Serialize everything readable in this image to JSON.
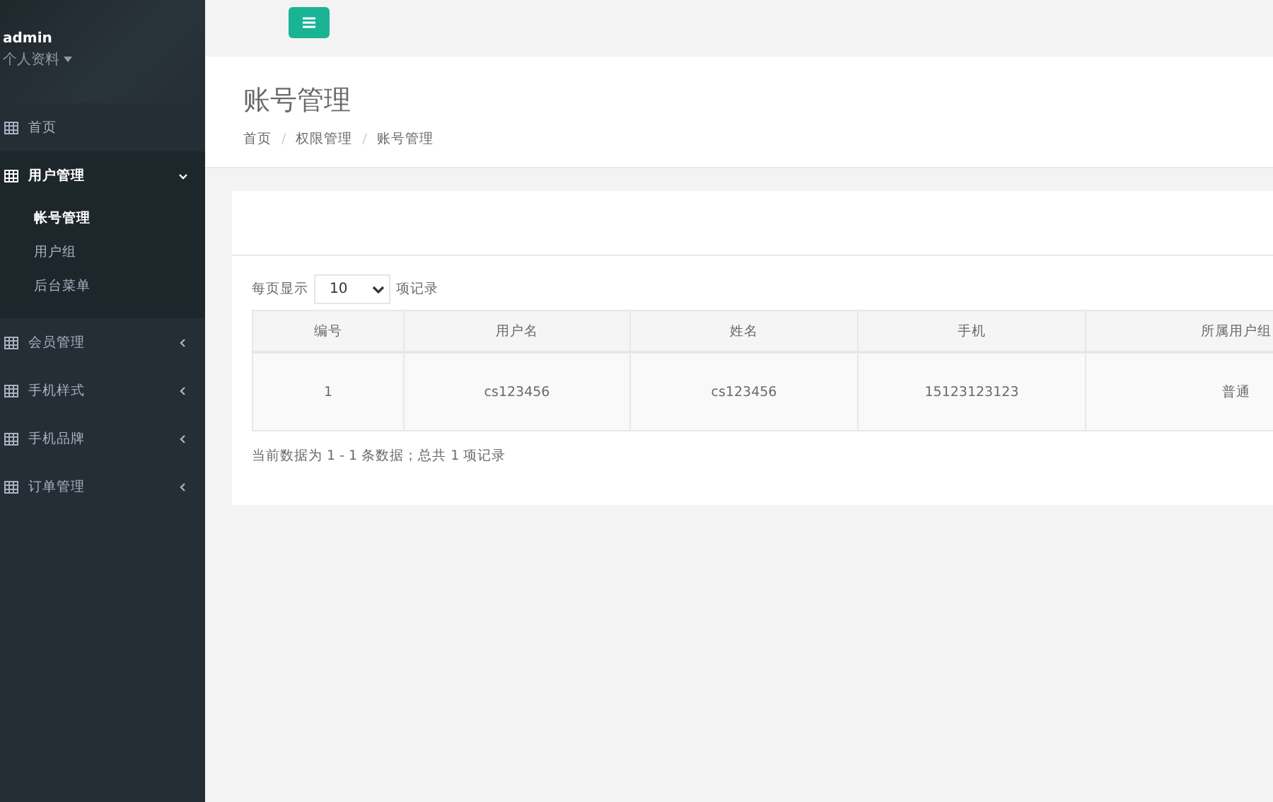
{
  "sidebar": {
    "profile": {
      "name": "admin",
      "menu": "个人资料"
    },
    "items": [
      {
        "label": "首页",
        "kind": "link",
        "expanded": false
      },
      {
        "label": "用户管理",
        "kind": "menu",
        "expanded": true,
        "children": [
          {
            "label": "帐号管理",
            "selected": true
          },
          {
            "label": "用户组",
            "selected": false
          },
          {
            "label": "后台菜单",
            "selected": false
          }
        ]
      },
      {
        "label": "会员管理",
        "kind": "menu",
        "expanded": false
      },
      {
        "label": "手机样式",
        "kind": "menu",
        "expanded": false
      },
      {
        "label": "手机品牌",
        "kind": "menu",
        "expanded": false
      },
      {
        "label": "订单管理",
        "kind": "menu",
        "expanded": false
      }
    ]
  },
  "page_header": {
    "title": "账号管理",
    "breadcrumb": [
      "首页",
      "权限管理",
      "账号管理"
    ],
    "breadcrumb_separators": [
      "/",
      "/"
    ]
  },
  "table_controls": {
    "prefix": "每页显示",
    "page_size": "10",
    "suffix": "项记录"
  },
  "table": {
    "columns": [
      "编号",
      "用户名",
      "姓名",
      "手机",
      "所属用户组"
    ],
    "rows": [
      [
        "1",
        "cs123456",
        "cs123456",
        "15123123123",
        "普通"
      ]
    ]
  },
  "summary": "当前数据为 1 - 1 条数据；总共 1 项记录"
}
